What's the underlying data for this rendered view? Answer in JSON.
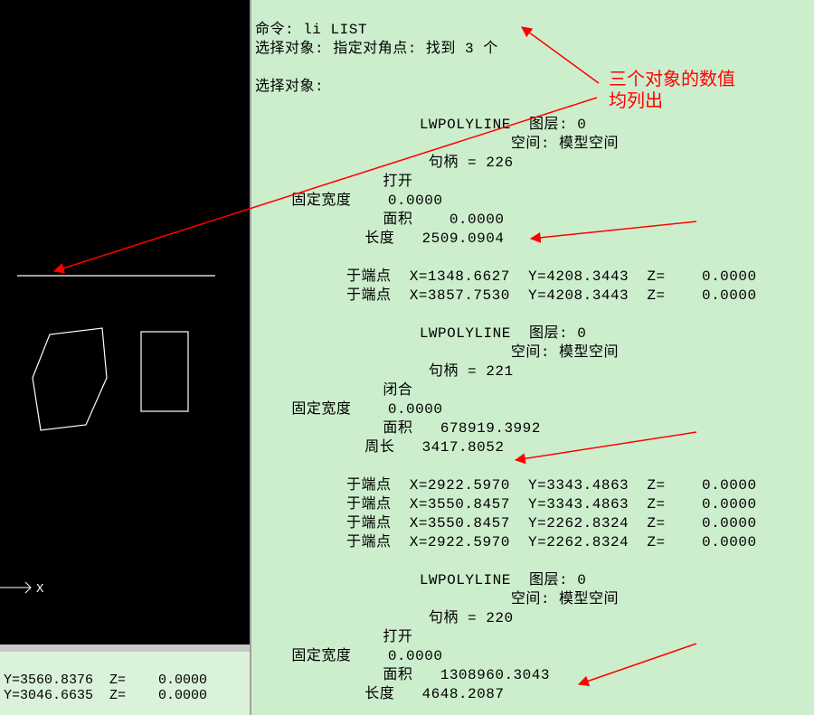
{
  "drawing": {
    "ucs_x": "X"
  },
  "status": {
    "line1": "Y=3560.8376  Z=    0.0000",
    "line2": "Y=3046.6635  Z=    0.0000"
  },
  "annotation": {
    "line1": "三个对象的数值",
    "line2": "均列出"
  },
  "cmd": {
    "l01": "命令: li LIST",
    "l02": "选择对象: 指定对角点: 找到 3 个",
    "l03": "",
    "l04": "选择对象:",
    "l05": "",
    "l06": "                  LWPOLYLINE  图层: 0",
    "l07": "                            空间: 模型空间",
    "l08": "                   句柄 = 226",
    "l09": "              打开",
    "l10": "    固定宽度    0.0000",
    "l11": "              面积    0.0000",
    "l12": "            长度   2509.0904",
    "l13": "",
    "l14": "          于端点  X=1348.6627  Y=4208.3443  Z=    0.0000",
    "l15": "          于端点  X=3857.7530  Y=4208.3443  Z=    0.0000",
    "l16": "",
    "l17": "                  LWPOLYLINE  图层: 0",
    "l18": "                            空间: 模型空间",
    "l19": "                   句柄 = 221",
    "l20": "              闭合",
    "l21": "    固定宽度    0.0000",
    "l22": "              面积   678919.3992",
    "l23": "            周长   3417.8052",
    "l24": "",
    "l25": "          于端点  X=2922.5970  Y=3343.4863  Z=    0.0000",
    "l26": "          于端点  X=3550.8457  Y=3343.4863  Z=    0.0000",
    "l27": "          于端点  X=3550.8457  Y=2262.8324  Z=    0.0000",
    "l28": "          于端点  X=2922.5970  Y=2262.8324  Z=    0.0000",
    "l29": "",
    "l30": "                  LWPOLYLINE  图层: 0",
    "l31": "                            空间: 模型空间",
    "l32": "                   句柄 = 220",
    "l33": "              打开",
    "l34": "    固定宽度    0.0000",
    "l35": "              面积   1308960.3043",
    "l36": "            长度   4648.2087"
  }
}
